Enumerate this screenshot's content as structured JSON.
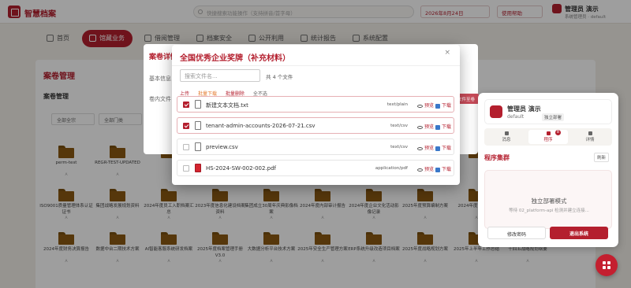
{
  "app": {
    "brand": "智慧档案"
  },
  "header": {
    "search_placeholder": "快捷搜索功能操作（支持拼音/首字母）",
    "date": "2026年8月24日",
    "help": "使用帮助",
    "user_name": "管理员 演示",
    "user_sub": "系统管理员 · default"
  },
  "nav": [
    {
      "label": "首页"
    },
    {
      "label": "馆藏业务"
    },
    {
      "label": "借阅管理"
    },
    {
      "label": "档案安全"
    },
    {
      "label": "公开利用"
    },
    {
      "label": "统计报告"
    },
    {
      "label": "系统配置"
    }
  ],
  "main": {
    "title": "案卷管理",
    "section": "案卷管理",
    "filter1": "全部全宗",
    "filter2": "全部门类"
  },
  "folders": [
    {
      "name": "perm-test",
      "tag": "A"
    },
    {
      "name": "REGR-TEST-UPDATED",
      "tag": "A"
    },
    {
      "name": "",
      "tag": ""
    },
    {
      "name": "",
      "tag": ""
    },
    {
      "name": "",
      "tag": ""
    },
    {
      "name": "",
      "tag": ""
    },
    {
      "name": "",
      "tag": ""
    },
    {
      "name": "",
      "tag": ""
    },
    {
      "name": "",
      "tag": ""
    },
    {
      "name": "",
      "tag": ""
    },
    {
      "name": "ISO9001质量管理体系认证证书",
      "tag": "A"
    },
    {
      "name": "集团战略发展规划资料",
      "tag": "A"
    },
    {
      "name": "2024年度员工入职档案汇总",
      "tag": "A"
    },
    {
      "name": "2023年度信息化建设档案资料",
      "tag": "A"
    },
    {
      "name": "集团成立30周年庆典影像档案",
      "tag": "A"
    },
    {
      "name": "2024年度内部审计报告",
      "tag": "A"
    },
    {
      "name": "2024年度企业文化活动影像记录",
      "tag": "A"
    },
    {
      "name": "2025年度预算编制方案",
      "tag": "A"
    },
    {
      "name": "2024年度审计报告",
      "tag": "A"
    },
    {
      "name": "",
      "tag": ""
    },
    {
      "name": "2024年度财务决算报告",
      "tag": "A"
    },
    {
      "name": "数据中台二期技术方案",
      "tag": "A"
    },
    {
      "name": "AI智能客服系统研发档案",
      "tag": "A"
    },
    {
      "name": "2025年度档案管理手册V3.0",
      "tag": "A"
    },
    {
      "name": "大数据分析平台技术方案",
      "tag": "A"
    },
    {
      "name": "2025年安全生产管理方案",
      "tag": "A"
    },
    {
      "name": "ERP系统升级改造项目档案",
      "tag": "A"
    },
    {
      "name": "2025年度战略规划方案",
      "tag": "A"
    },
    {
      "name": "2025年上半年工作总结",
      "tag": "A"
    },
    {
      "name": "十四五战略规划纲要",
      "tag": "A"
    }
  ],
  "bg_modal": {
    "title": "案卷详情",
    "basic_label": "基本信息",
    "inner_label": "卷内文件",
    "action": "上传文件至卷"
  },
  "modal": {
    "title": "全国优秀企业奖牌（补充材料）",
    "close": "×",
    "search_placeholder": "搜索文件名...",
    "count_text": "共 4 个文件",
    "actions": {
      "upload": "上传",
      "batch_download": "批量下载",
      "batch_delete": "批量删除",
      "select_all": "全不选"
    },
    "files": [
      {
        "name": "新建文本文档.txt",
        "type": "text/plain",
        "checked": true,
        "kind": "txt"
      },
      {
        "name": "tenant-admin-accounts-2026-07-21.csv",
        "type": "text/csv",
        "checked": true,
        "kind": "csv"
      },
      {
        "name": "preview.csv",
        "type": "text/csv",
        "checked": false,
        "kind": "csv"
      },
      {
        "name": "HS-2024-SW-002-002.pdf",
        "type": "application/pdf",
        "checked": false,
        "kind": "pdf"
      }
    ],
    "preview_label": "预览",
    "download_label": "下载"
  },
  "panel": {
    "user_name": "管理员 演示",
    "user_sub": "default",
    "badge": "独立部署",
    "tabs": [
      {
        "label": "消息"
      },
      {
        "label": "程序",
        "badge": "8"
      },
      {
        "label": "详情"
      }
    ],
    "section": "程序集群",
    "refresh": "刷新",
    "box_title": "独立部署模式",
    "box_sub": "等待 02_platform-api 检测并建立连接...",
    "btn_change_pwd": "修改密码",
    "btn_logout": "退出系统"
  },
  "colors": {
    "accent": "#b41f2e",
    "folder": "#8c5a12"
  }
}
